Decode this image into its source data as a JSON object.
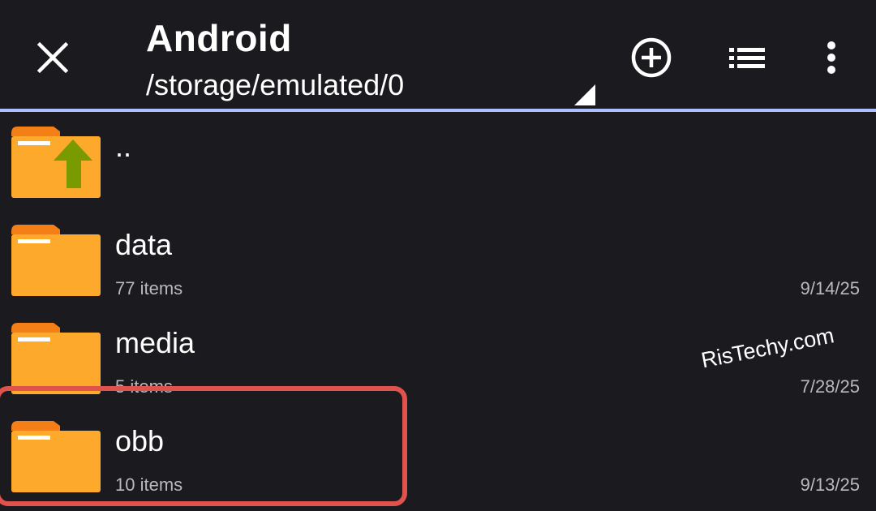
{
  "toolbar": {
    "title": "Android",
    "path": "/storage/emulated/0",
    "divider_color": "#aebfff",
    "icons": [
      "close-icon",
      "add-circle-icon",
      "list-view-icon",
      "more-vert-icon"
    ]
  },
  "list": {
    "parent": {
      "name": ".."
    },
    "items": [
      {
        "name": "data",
        "meta": "77 items",
        "date": "9/14/25"
      },
      {
        "name": "media",
        "meta": "5 items",
        "date": "7/28/25"
      },
      {
        "name": "obb",
        "meta": "10 items",
        "date": "9/13/25"
      }
    ]
  },
  "highlight": {
    "target": "obb",
    "color": "#e0534d"
  },
  "watermark": {
    "text": "RisTechy.com"
  },
  "colors": {
    "background": "#1b1b1f",
    "folder_body": "#fda92b",
    "folder_tab": "#f57f17",
    "up_arrow": "#7a9a01",
    "secondary_text": "#b9b9bd"
  }
}
